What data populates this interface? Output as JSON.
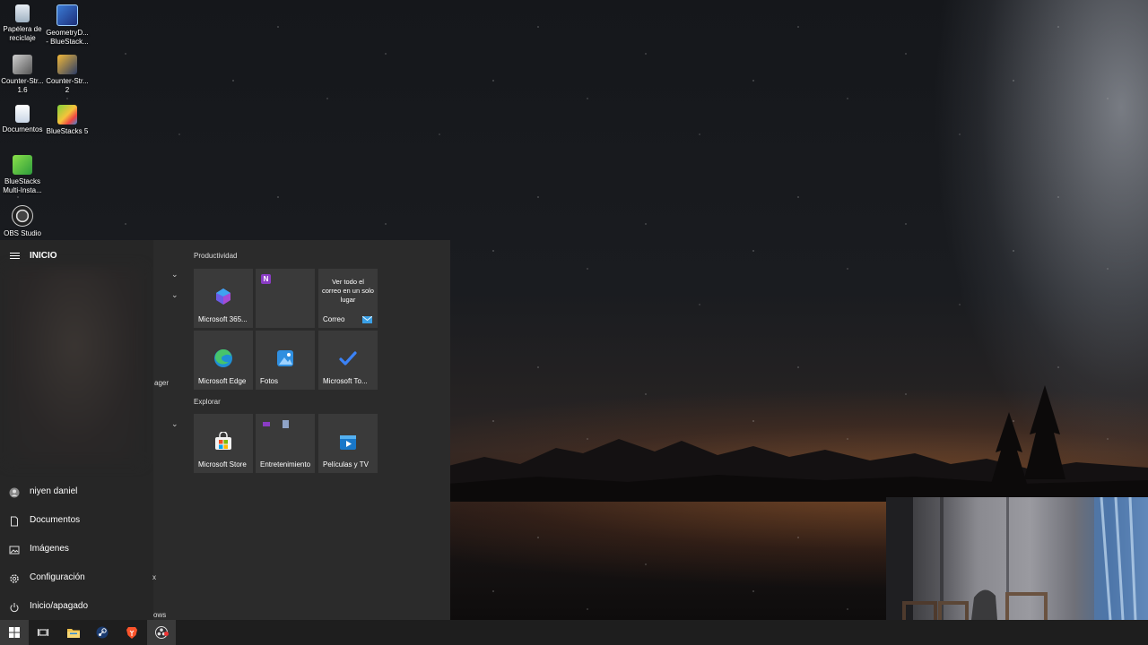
{
  "desktop_icons": [
    {
      "label": "Papelera de reciclaje",
      "icon": "recycle-bin-icon"
    },
    {
      "label": "GeometryD... - BlueStack...",
      "icon": "geometry-dash-icon"
    },
    {
      "label": "Counter-Str... 1.6",
      "icon": "counter-strike-icon"
    },
    {
      "label": "Counter-Str... 2",
      "icon": "counter-strike-2-icon"
    },
    {
      "label": "Documentos",
      "icon": "documents-icon"
    },
    {
      "label": "BlueStacks 5",
      "icon": "bluestacks-icon"
    },
    {
      "label": "BlueStacks Multi-Insta...",
      "icon": "bluestacks-multi-icon"
    },
    {
      "label": "OBS Studio",
      "icon": "obs-icon"
    }
  ],
  "start_menu": {
    "title": "INICIO",
    "nav": [
      {
        "label": "niyen daniel",
        "icon": "user-icon"
      },
      {
        "label": "Documentos",
        "icon": "document-icon"
      },
      {
        "label": "Imágenes",
        "icon": "pictures-icon"
      },
      {
        "label": "Configuración",
        "icon": "gear-icon"
      },
      {
        "label": "Inicio/apagado",
        "icon": "power-icon"
      }
    ],
    "partial_labels": {
      "anager": "ager",
      "x": "x",
      "ows": "ows"
    },
    "groups": [
      {
        "title": "Productividad",
        "tiles": [
          {
            "label": "Microsoft 365...",
            "icon": "microsoft-365-icon"
          },
          {
            "label": "",
            "icon": "onenote-icon"
          },
          {
            "label": "Correo",
            "icon": "mail-icon",
            "center_text": "Ver todo el correo en un solo lugar"
          },
          {
            "label": "Microsoft Edge",
            "icon": "edge-icon"
          },
          {
            "label": "Fotos",
            "icon": "photos-icon"
          },
          {
            "label": "Microsoft To...",
            "icon": "todo-icon"
          }
        ]
      },
      {
        "title": "Explorar",
        "tiles": [
          {
            "label": "Microsoft Store",
            "icon": "store-icon"
          },
          {
            "label": "Entretenimiento",
            "icon": "entertainment-icon"
          },
          {
            "label": "Películas y TV",
            "icon": "movies-tv-icon"
          }
        ]
      }
    ]
  },
  "taskbar": {
    "items": [
      {
        "name": "start-button",
        "icon": "windows-icon"
      },
      {
        "name": "task-view-button",
        "icon": "task-view-icon"
      },
      {
        "name": "file-explorer-button",
        "icon": "folder-icon"
      },
      {
        "name": "steam-button",
        "icon": "steam-icon"
      },
      {
        "name": "brave-button",
        "icon": "brave-icon"
      },
      {
        "name": "obs-taskbar-button",
        "icon": "obs-icon"
      }
    ]
  },
  "colors": {
    "start_left_bg": "#262626",
    "start_tiles_bg": "#2b2b2b",
    "tile_bg": "#3a3a3a",
    "taskbar_bg": "#1e1e1e"
  }
}
